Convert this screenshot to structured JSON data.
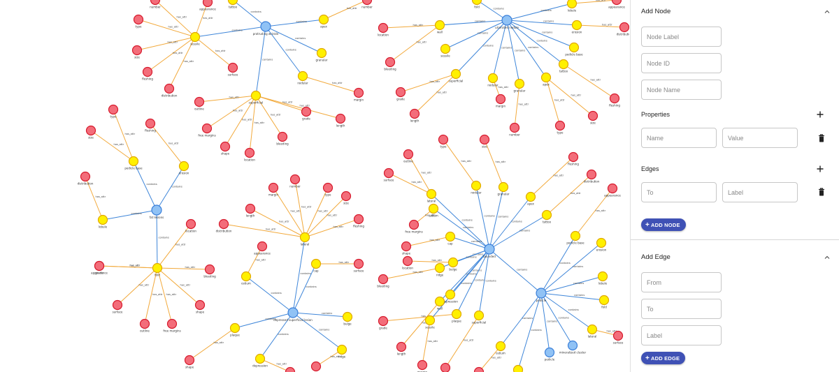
{
  "add_node": {
    "title": "Add Node",
    "label_placeholder": "Node Label",
    "id_placeholder": "Node ID",
    "name_placeholder": "Node Name",
    "properties_title": "Properties",
    "prop_name_placeholder": "Name",
    "prop_value_placeholder": "Value",
    "edges_title": "Edges",
    "edge_to_placeholder": "To",
    "edge_label_placeholder": "Label",
    "button_label": "ADD NODE"
  },
  "add_edge": {
    "title": "Add Edge",
    "from_placeholder": "From",
    "to_placeholder": "To",
    "label_placeholder": "Label",
    "button_label": "ADD EDGE"
  },
  "colors": {
    "hub_fill": "#90c2f5",
    "hub_stroke": "#3b7fd9",
    "mid_fill": "#fff000",
    "mid_stroke": "#e0a800",
    "leaf_fill": "#f36d7a",
    "leaf_stroke": "#d61a2c",
    "blue_edge": "#3f86d9",
    "orange_edge": "#f2a93b",
    "accent": "#3f51b5"
  },
  "graph": {
    "hub_labels": [
      "protruding wrinkle",
      "fat lesions",
      "depressed superficial lesion",
      "ulcerated nodule",
      "bounded",
      "pedicle",
      "mineralized cluster"
    ],
    "mid_labels": [
      "sessile",
      "superficial",
      "nodular",
      "granular",
      "apex",
      "tattoo",
      "pedicle base",
      "erosion",
      "lobule",
      "fold",
      "lateral",
      "ostium",
      "cap",
      "bulge",
      "ridge",
      "depression",
      "plaque",
      "wall"
    ],
    "leaf_labels": [
      "number",
      "type",
      "size",
      "fleshing",
      "distribution",
      "appearance",
      "surface",
      "outline",
      "free margins",
      "shape",
      "location",
      "bleeding",
      "grade",
      "length",
      "margin"
    ],
    "edge_labels": [
      "has_attr",
      "contains"
    ]
  }
}
